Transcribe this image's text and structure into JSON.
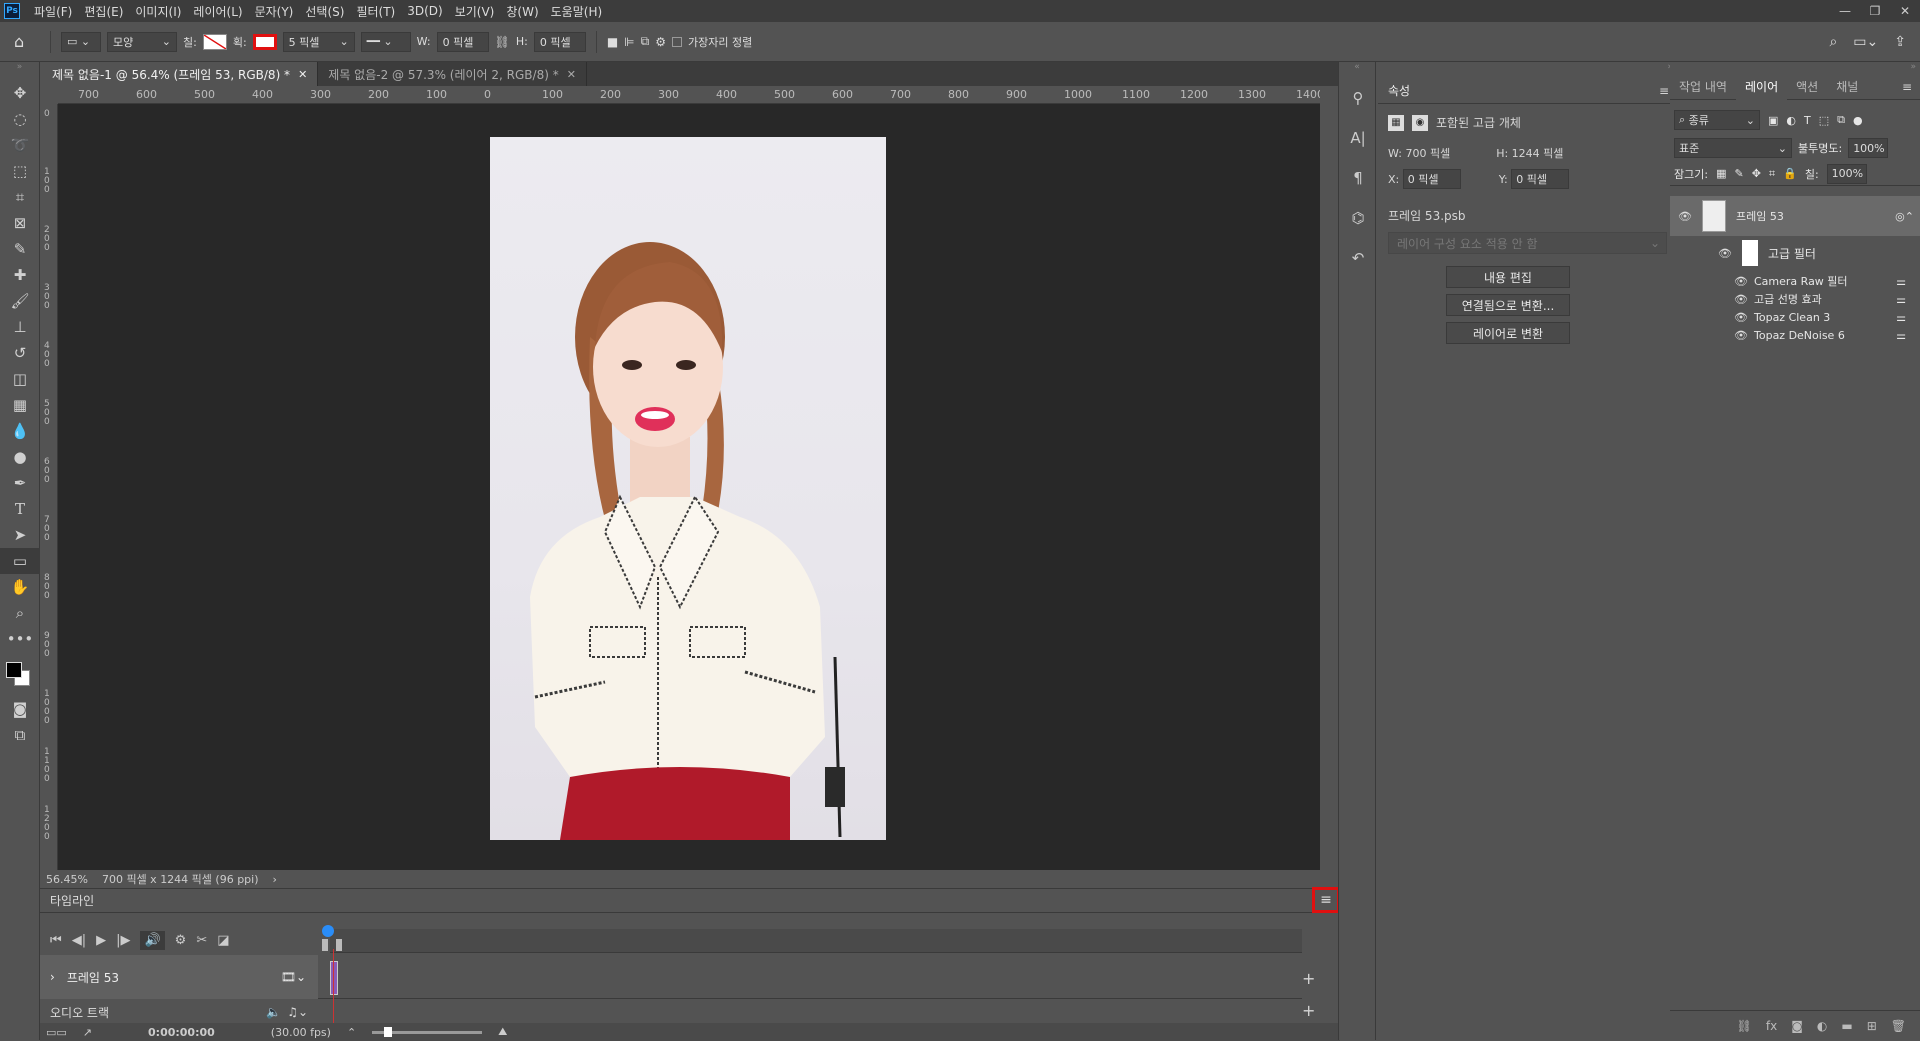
{
  "app": {
    "logo": "Ps"
  },
  "menu": [
    "파일(F)",
    "편집(E)",
    "이미지(I)",
    "레이어(L)",
    "문자(Y)",
    "선택(S)",
    "필터(T)",
    "3D(D)",
    "보기(V)",
    "창(W)",
    "도움말(H)"
  ],
  "options": {
    "shape_mode": "모양",
    "fill_label": "칠:",
    "stroke_label": "획:",
    "stroke_width": "5 픽셀",
    "w_label": "W:",
    "w_value": "0 픽셀",
    "h_label": "H:",
    "h_value": "0 픽셀",
    "align_edges": "가장자리 정렬"
  },
  "doc_tabs": [
    {
      "label": "제목 없음-1 @ 56.4% (프레임 53, RGB/8) *",
      "active": true
    },
    {
      "label": "제목 없음-2 @ 57.3% (레이어 2, RGB/8) *",
      "active": false
    }
  ],
  "ruler_top": [
    "700",
    "600",
    "500",
    "400",
    "300",
    "200",
    "100",
    "0",
    "100",
    "200",
    "300",
    "400",
    "500",
    "600",
    "700",
    "800",
    "900",
    "1000",
    "1100",
    "1200",
    "1300",
    "1400"
  ],
  "ruler_left": [
    "0",
    "1\n0\n0",
    "2\n0\n0",
    "3\n0\n0",
    "4\n0\n0",
    "5\n0\n0",
    "6\n0\n0",
    "7\n0\n0",
    "8\n0\n0",
    "9\n0\n0",
    "1\n0\n0\n0",
    "1\n1\n0\n0",
    "1\n2\n0\n0"
  ],
  "status": {
    "zoom": "56.45%",
    "doc_size": "700 픽셀 x 1244 픽셀 (96 ppi)"
  },
  "timeline": {
    "title": "타임라인",
    "menu_icon": "hamburger-icon",
    "track_name": "프레임 53",
    "audio_track": "오디오 트랙",
    "timecode": "0:00:00:00",
    "fps": "(30.00 fps)"
  },
  "properties": {
    "tab": "속성",
    "type_label": "포함된 고급 개체",
    "w_label": "W:",
    "w_value": "700 픽셀",
    "h_label": "H:",
    "h_value": "1244 픽셀",
    "x_label": "X:",
    "x_value": "0 픽셀",
    "y_label": "Y:",
    "y_value": "0 픽셀",
    "file_name": "프레임 53.psb",
    "comp_select": "레이어 구성 요소 적용 안 함",
    "btn_edit": "내용 편집",
    "btn_convert_linked": "연결됨으로 변환...",
    "btn_convert_layer": "레이어로 변환"
  },
  "layers_panel": {
    "tabs": [
      "작업 내역",
      "레이어",
      "액션",
      "채널"
    ],
    "active_tab": "레이어",
    "filter_kind": "종류",
    "blend_mode": "표준",
    "opacity_label": "불투명도:",
    "opacity": "100%",
    "lock_label": "잠그기:",
    "fill_label": "칠:",
    "fill": "100%",
    "layer_name": "프레임 53",
    "smart_filters": "고급 필터",
    "filters": [
      "Camera Raw 필터",
      "고급 선명 효과",
      "Topaz Clean 3",
      "Topaz DeNoise 6"
    ]
  },
  "colors": {
    "highlight": "#e01010",
    "panel": "#535353",
    "canvas": "#282828"
  }
}
